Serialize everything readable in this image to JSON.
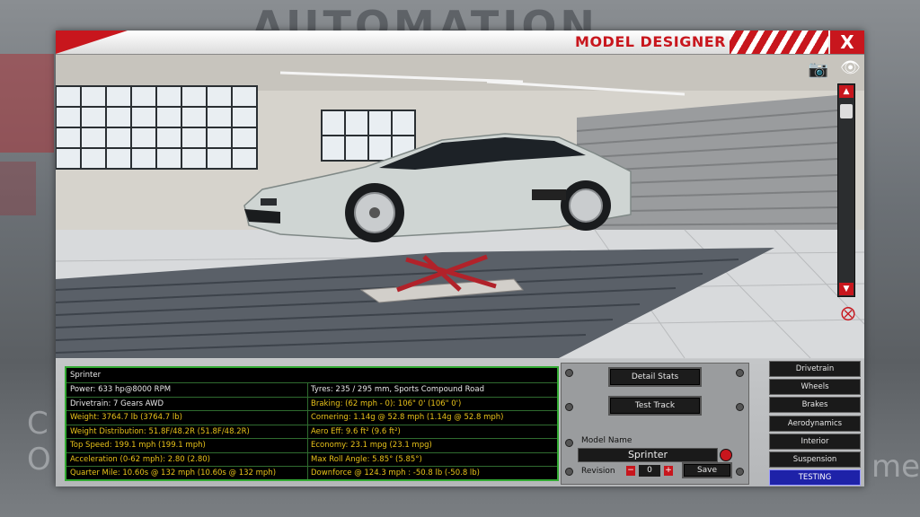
{
  "background": {
    "logo_text": "AUTOMATION",
    "left_text": "C\nO",
    "right_text": "me"
  },
  "window": {
    "title": "MODEL DESIGNER",
    "close_label": "X",
    "accent": "#c8161d"
  },
  "viewport": {
    "camera_icon": "camera-icon",
    "eye_icon": "eye-icon",
    "scroll_up": "▲",
    "scroll_down": "▼"
  },
  "stats": {
    "name": "Sprinter",
    "rows": [
      {
        "left": "Power: 633 hp@8000 RPM",
        "right": "Tyres: 235 / 295 mm, Sports Compound Road",
        "left_hl": false,
        "right_hl": false
      },
      {
        "left": "Drivetrain: 7 Gears AWD",
        "right": "Braking: (62 mph - 0): 106\" 0' (106\" 0')",
        "left_hl": false,
        "right_hl": true
      },
      {
        "left": "Weight: 3764.7 lb (3764.7 lb)",
        "right": "Cornering: 1.14g @ 52.8 mph (1.14g @ 52.8 mph)",
        "left_hl": true,
        "right_hl": true
      },
      {
        "left": "Weight Distribution: 51.8F/48.2R (51.8F/48.2R)",
        "right": "Aero Eff: 9.6 ft² (9.6 ft²)",
        "left_hl": true,
        "right_hl": true
      },
      {
        "left": "Top Speed: 199.1 mph (199.1 mph)",
        "right": "Economy: 23.1 mpg (23.1 mpg)",
        "left_hl": true,
        "right_hl": true
      },
      {
        "left": "Acceleration (0-62 mph): 2.80 (2.80)",
        "right": "Max Roll Angle: 5.85° (5.85°)",
        "left_hl": true,
        "right_hl": true
      },
      {
        "left": "Quarter Mile: 10.60s @ 132 mph (10.60s @ 132 mph)",
        "right": "Downforce @ 124.3 mph : -50.8 lb (-50.8 lb)",
        "left_hl": true,
        "right_hl": true
      }
    ]
  },
  "actions": {
    "detail_stats": "Detail Stats",
    "test_track": "Test Track"
  },
  "model": {
    "name_label": "Model Name",
    "name_value": "Sprinter",
    "revision_label": "Revision",
    "revision_value": "0",
    "minus": "−",
    "plus": "+",
    "save": "Save"
  },
  "tabs": [
    "Drivetrain",
    "Wheels",
    "Brakes",
    "Aerodynamics",
    "Interior",
    "Suspension",
    "TESTING"
  ],
  "active_tab": "TESTING"
}
